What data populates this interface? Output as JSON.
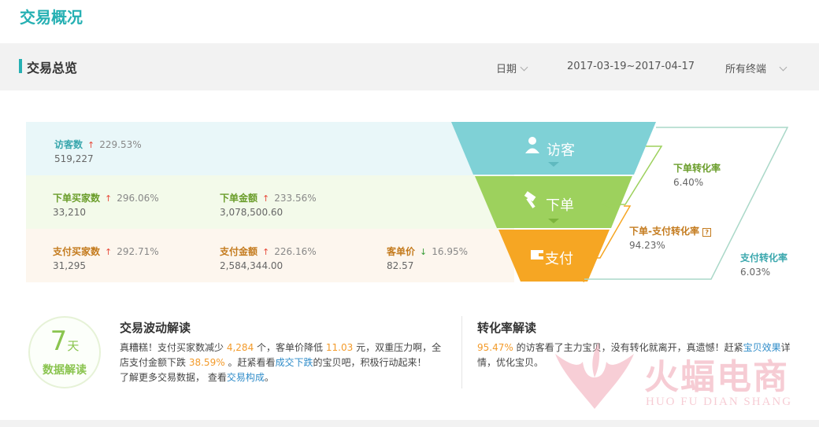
{
  "page_title": "交易概况",
  "summary": {
    "title": "交易总览",
    "date_label": "日期",
    "date_range": "2017-03-19~2017-04-17",
    "terminal": "所有终端"
  },
  "rows": {
    "visitors": {
      "name": "访客数",
      "pct": "229.53%",
      "value": "519,227"
    },
    "order_buyers": {
      "name": "下单买家数",
      "pct": "296.06%",
      "value": "33,210"
    },
    "order_amount": {
      "name": "下单金额",
      "pct": "233.56%",
      "value": "3,078,500.60"
    },
    "pay_buyers": {
      "name": "支付买家数",
      "pct": "292.71%",
      "value": "31,295"
    },
    "pay_amount": {
      "name": "支付金额",
      "pct": "226.16%",
      "value": "2,584,344.00"
    },
    "unit_price": {
      "name": "客单价",
      "pct": "16.95%",
      "value": "82.57"
    }
  },
  "funnel": {
    "visit_label": "访客",
    "order_label": "下单",
    "pay_label": "支付",
    "colors": {
      "visit": "#7fd1d6",
      "order": "#9dd15d",
      "pay": "#f6a623"
    },
    "order_rate": {
      "name": "下单转化率",
      "value": "6.40%"
    },
    "order_pay_rate": {
      "name": "下单-支付转化率",
      "value": "94.23%"
    },
    "pay_rate": {
      "name": "支付转化率",
      "value": "6.03%"
    }
  },
  "insight": {
    "days_num": "7",
    "days_unit": "天",
    "days_sub": "数据解读",
    "wave_title": "交易波动解读",
    "p1_a": "真糟糕！支付买家数减少",
    "p1_n1": "4,284",
    "p1_b": "个，客单价降低",
    "p1_n2": "11.03",
    "p1_c": "元，双重压力啊，全",
    "p2_a": "店支付金额下跌",
    "p2_n1": "38.59%",
    "p2_b": "。赶紧看看",
    "p2_link": "成交下跌",
    "p2_c": "的宝贝吧，积极行动起来！",
    "p3_a": "了解更多交易数据，  查看",
    "p3_link": "交易构成",
    "p3_b": "。",
    "conv_title": "转化率解读",
    "c1_n": "95.47%",
    "c1_a": "的访客看了主力宝贝，没有转化就离开，真遗憾！赶紧",
    "c1_link": "宝贝效果",
    "c1_b": "详",
    "c2": "情，优化宝贝。"
  },
  "watermark": {
    "brand": "火蝠电商",
    "sub": "HUO FU DIAN SHANG"
  }
}
